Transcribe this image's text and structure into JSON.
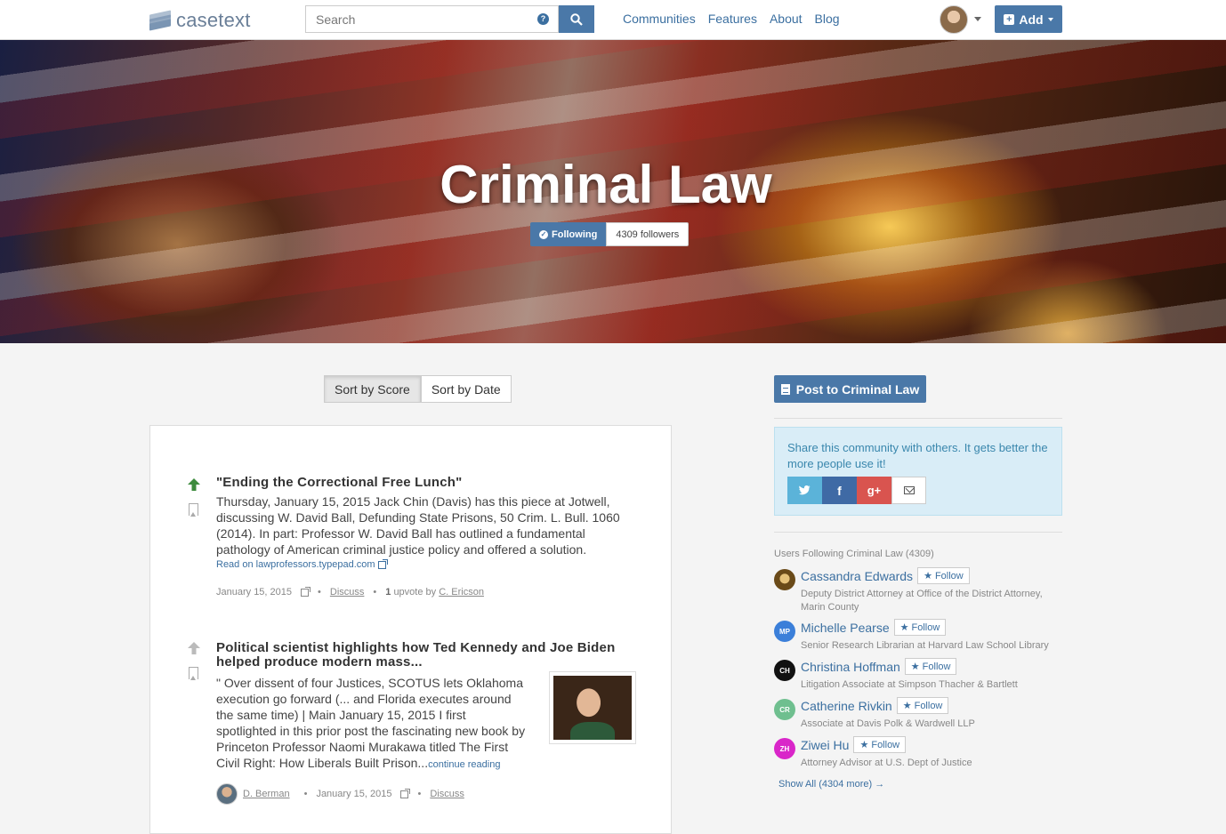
{
  "brand": {
    "name": "casetext"
  },
  "search": {
    "placeholder": "Search"
  },
  "nav": {
    "links": [
      "Communities",
      "Features",
      "About",
      "Blog"
    ],
    "add_label": "Add"
  },
  "hero": {
    "title": "Criminal Law",
    "following_label": "Following",
    "followers_label": "4309 followers"
  },
  "sort": {
    "score_label": "Sort by Score",
    "date_label": "Sort by Date"
  },
  "posts": [
    {
      "title": "\"Ending the Correctional Free Lunch\"",
      "text": "Thursday, January 15, 2015 Jack Chin (Davis) has this piece at Jotwell, discussing W. David Ball, Defunding State Prisons, 50 Crim. L. Bull. 1060 (2014). In part: Professor W. David Ball has outlined a fundamental pathology of American criminal justice policy and offered a solution.",
      "read_link": "Read on lawprofessors.typepad.com",
      "date": "January 15, 2015",
      "discuss": "Discuss",
      "upvotes_count": "1",
      "upvote_by": "upvote by",
      "upvoter": "C. Ericson"
    },
    {
      "title": "Political scientist highlights how Ted Kennedy and Joe Biden helped produce modern mass...",
      "text": "\" Over dissent of four Justices, SCOTUS lets Oklahoma execution go forward (... and Florida executes around the same time) | Main January 15, 2015 I first spotlighted in this prior post the fascinating new book by Princeton Professor Naomi Murakawa titled The First Civil Right: How Liberals Built Prison...",
      "continue_label": "continue reading",
      "author": "D. Berman",
      "date": "January 15, 2015",
      "discuss": "Discuss"
    }
  ],
  "sidebar": {
    "post_button": "Post to Criminal Law",
    "share_text": "Share this community with others. It gets better the more people use it!",
    "share_icons": [
      "twitter-icon",
      "facebook-icon",
      "google-plus-icon",
      "email-icon"
    ],
    "followers_heading": "Users Following Criminal Law (4309)",
    "follow_label": "Follow",
    "users": [
      {
        "name": "Cassandra Edwards",
        "initials": "",
        "color": "#8a6a2a",
        "desc": "Deputy District Attorney at Office of the District Attorney, Marin County"
      },
      {
        "name": "Michelle Pearse",
        "initials": "MP",
        "color": "#3b7fd9",
        "desc": "Senior Research Librarian at Harvard Law School Library"
      },
      {
        "name": "Christina Hoffman",
        "initials": "CH",
        "color": "#111111",
        "desc": "Litigation Associate at Simpson Thacher & Bartlett"
      },
      {
        "name": "Catherine Rivkin",
        "initials": "CR",
        "color": "#6fbf8f",
        "desc": "Associate at Davis Polk & Wardwell LLP"
      },
      {
        "name": "Ziwei Hu",
        "initials": "ZH",
        "color": "#d926c9",
        "desc": "Attorney Advisor at U.S. Dept of Justice"
      }
    ],
    "show_all": "Show All (4304 more) →"
  },
  "colors": {
    "primary": "#4a78a8",
    "link": "#3b6fa0",
    "upvote_active": "#3d8b3d",
    "upvote_inactive": "#bbbbbb"
  }
}
